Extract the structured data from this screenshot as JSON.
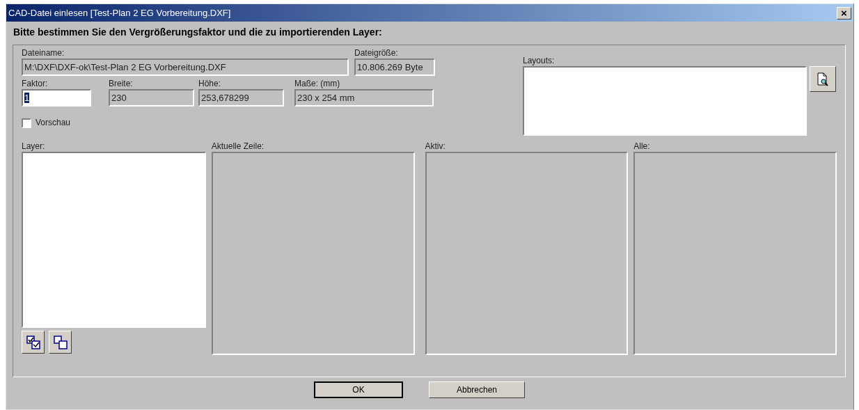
{
  "window": {
    "title": "CAD-Datei einlesen [Test-Plan 2 EG Vorbereitung.DXF]",
    "close": "×"
  },
  "heading": "Bitte bestimmen Sie den Vergrößerungsfaktor und die zu importierenden Layer:",
  "file_row": [
    {
      "label": "Dateiname:",
      "value": "M:\\DXF\\DXF-ok\\Test-Plan 2 EG Vorbereitung.DXF",
      "readonly": true
    },
    {
      "label": "Dateigröße:",
      "value": "10.806.269 Byte",
      "readonly": true
    }
  ],
  "size_row": [
    {
      "label": "Faktor:",
      "value": "1",
      "readonly": false,
      "value_selected": true
    },
    {
      "label": "Breite:",
      "value": "230",
      "readonly": true,
      "value_selected": false
    },
    {
      "label": "Höhe:",
      "value": "253,678299",
      "readonly": true,
      "value_selected": false
    },
    {
      "label": "Maße: (mm)",
      "value": "230 x 254 mm",
      "readonly": true,
      "value_selected": false
    }
  ],
  "preview_checkbox": {
    "label": "Vorschau",
    "checked": false
  },
  "layouts": {
    "label": "Layouts:"
  },
  "lists": [
    {
      "label": "Layer:",
      "enabled": true
    },
    {
      "label": "Aktuelle Zeile:",
      "enabled": false
    },
    {
      "label": "Aktiv:",
      "enabled": false
    },
    {
      "label": "Alle:",
      "enabled": false
    }
  ],
  "buttons": [
    "OK",
    "Abbrechen"
  ]
}
